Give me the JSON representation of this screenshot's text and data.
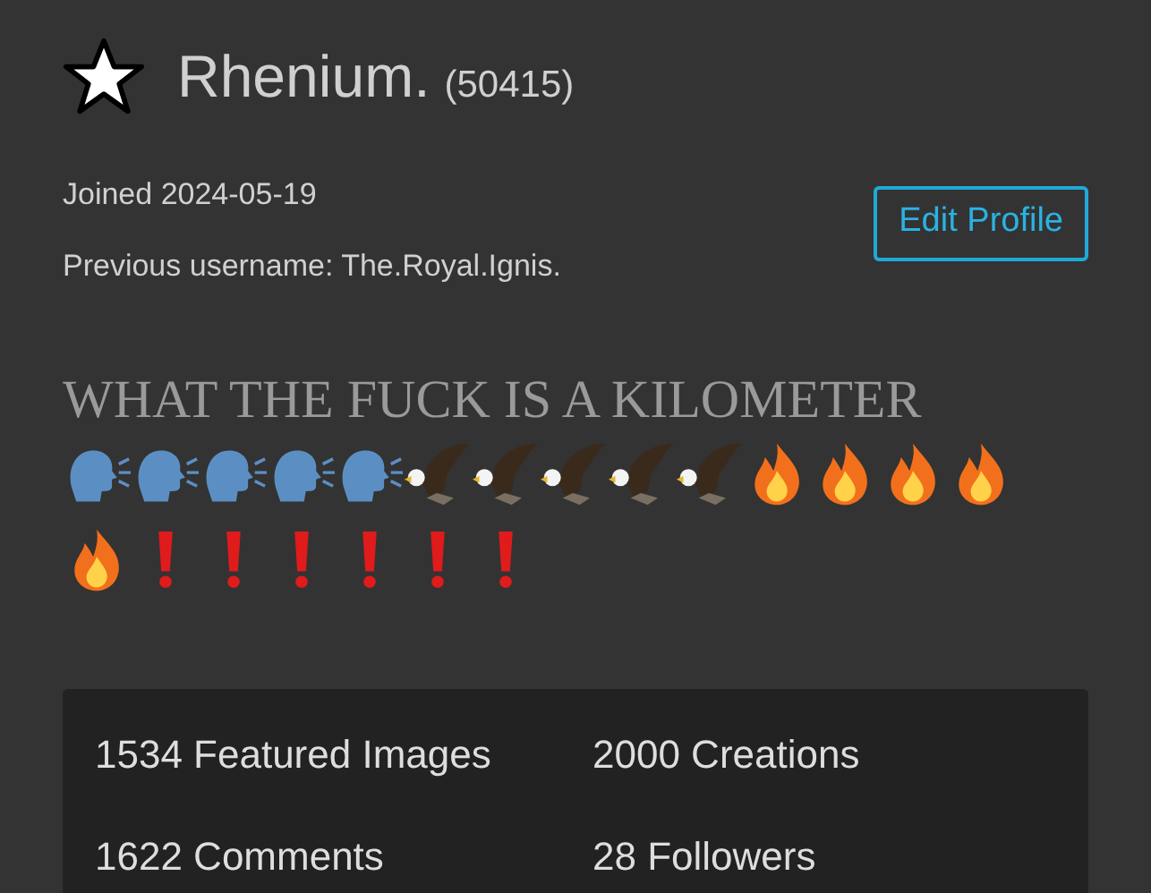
{
  "profile": {
    "username": "Rhenium.",
    "points": "(50415)",
    "joined": "Joined 2024-05-19",
    "previous_username": "Previous username: The.Royal.Ignis.",
    "edit_button": "Edit Profile"
  },
  "bio": {
    "text": "WHAT THE FUCK IS A KILOMETER",
    "emojis": [
      {
        "kind": "speaking-head"
      },
      {
        "kind": "speaking-head"
      },
      {
        "kind": "speaking-head"
      },
      {
        "kind": "speaking-head"
      },
      {
        "kind": "speaking-head"
      },
      {
        "kind": "eagle"
      },
      {
        "kind": "eagle"
      },
      {
        "kind": "eagle"
      },
      {
        "kind": "eagle"
      },
      {
        "kind": "eagle"
      },
      {
        "kind": "fire"
      },
      {
        "kind": "fire"
      },
      {
        "kind": "fire"
      },
      {
        "kind": "fire"
      },
      {
        "kind": "fire"
      },
      {
        "kind": "exclamation"
      },
      {
        "kind": "exclamation"
      },
      {
        "kind": "exclamation"
      },
      {
        "kind": "exclamation"
      },
      {
        "kind": "exclamation"
      },
      {
        "kind": "exclamation"
      }
    ]
  },
  "stats": [
    "1534 Featured Images",
    "2000 Creations",
    "1622 Comments",
    "28 Followers"
  ]
}
